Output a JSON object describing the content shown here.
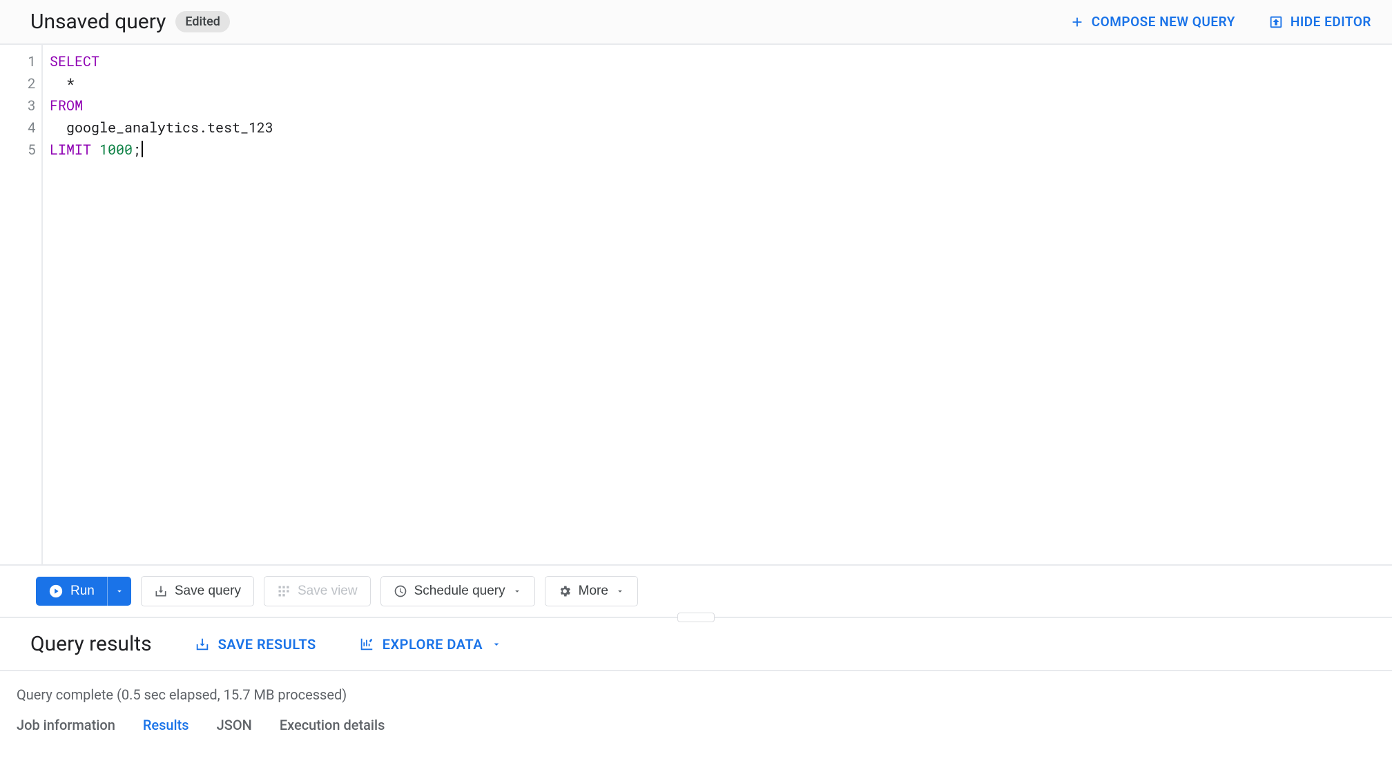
{
  "header": {
    "title": "Unsaved query",
    "badge": "Edited",
    "compose_label": "COMPOSE NEW QUERY",
    "hide_editor_label": "HIDE EDITOR"
  },
  "editor": {
    "line_numbers": [
      "1",
      "2",
      "3",
      "4",
      "5"
    ],
    "code_lines": [
      {
        "tokens": [
          {
            "t": "SELECT",
            "c": "kw"
          }
        ]
      },
      {
        "tokens": [
          {
            "t": "  *",
            "c": ""
          }
        ]
      },
      {
        "tokens": [
          {
            "t": "FROM",
            "c": "kw"
          }
        ]
      },
      {
        "tokens": [
          {
            "t": "  google_analytics.test_123",
            "c": ""
          }
        ]
      },
      {
        "tokens": [
          {
            "t": "LIMIT",
            "c": "kw"
          },
          {
            "t": " ",
            "c": ""
          },
          {
            "t": "1000",
            "c": "num"
          },
          {
            "t": ";",
            "c": ""
          }
        ],
        "cursor_after": true
      }
    ]
  },
  "toolbar": {
    "run_label": "Run",
    "save_query_label": "Save query",
    "save_view_label": "Save view",
    "schedule_label": "Schedule query",
    "more_label": "More"
  },
  "results": {
    "title": "Query results",
    "save_results_label": "SAVE RESULTS",
    "explore_data_label": "EXPLORE DATA",
    "status": "Query complete (0.5 sec elapsed, 15.7 MB processed)",
    "tabs": {
      "job_info": "Job information",
      "results": "Results",
      "json": "JSON",
      "exec_details": "Execution details"
    }
  }
}
